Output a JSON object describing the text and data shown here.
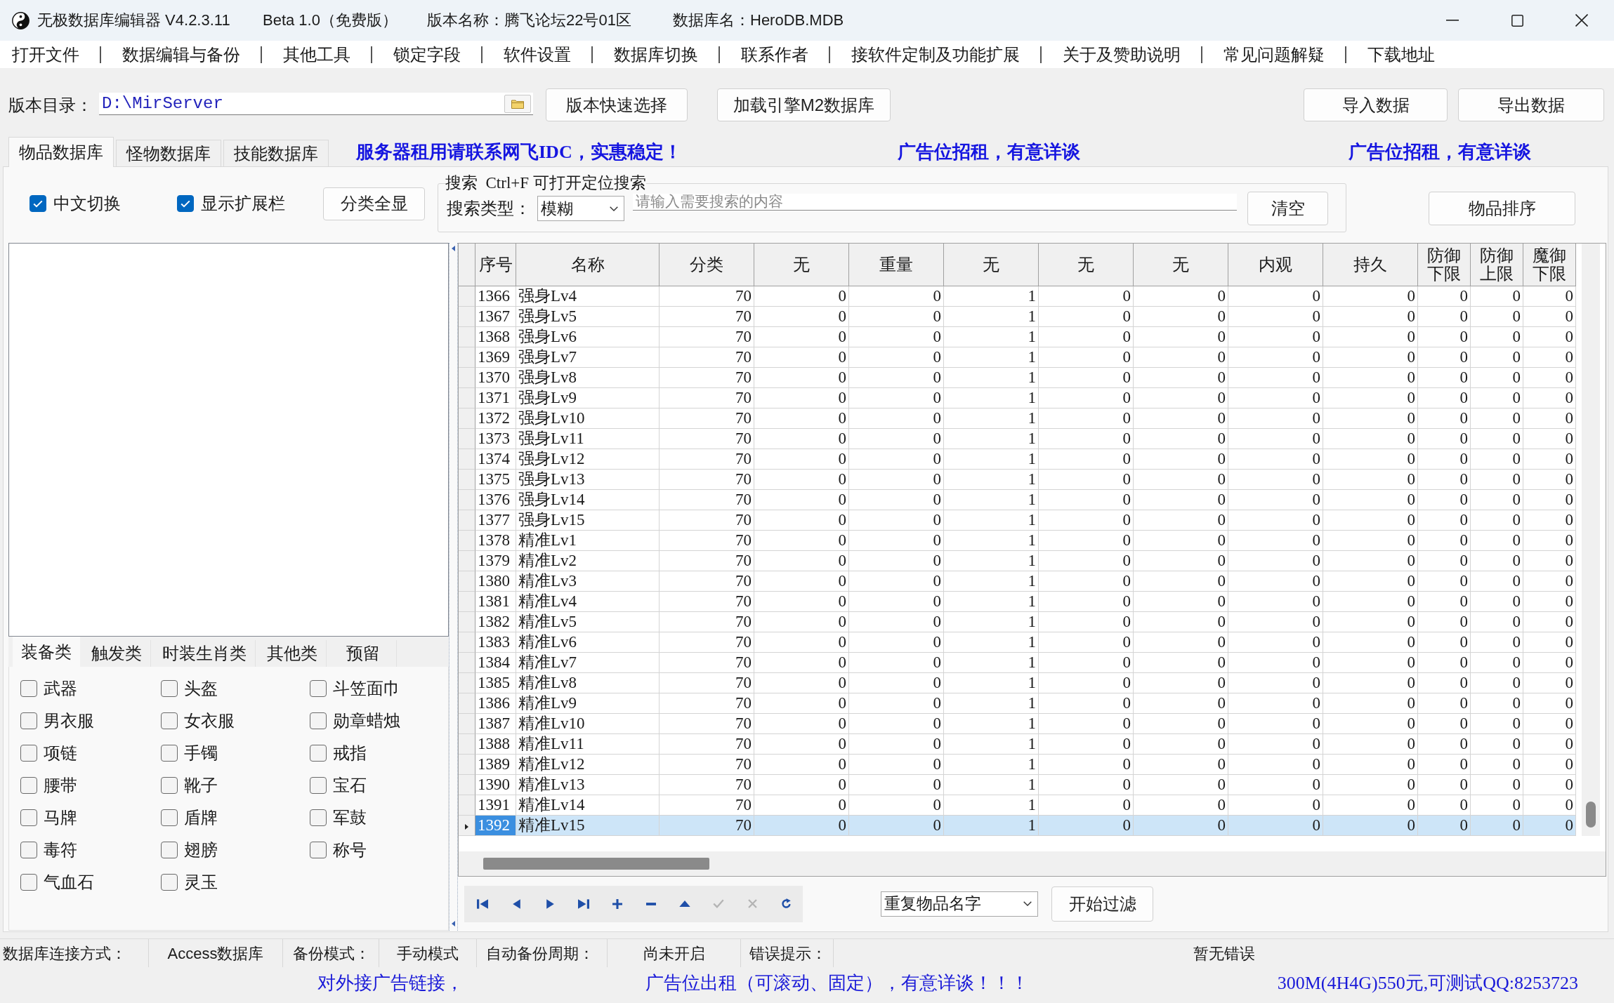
{
  "window": {
    "title": "无极数据库编辑器 V4.2.3.11",
    "edition": "Beta 1.0（免费版）",
    "version_name": "版本名称：腾飞论坛22号01区",
    "database_name": "数据库名：HeroDB.MDB"
  },
  "menu": [
    "打开文件",
    "数据编辑与备份",
    "其他工具",
    "锁定字段",
    "软件设置",
    "数据库切换",
    "联系作者",
    "接软件定制及功能扩展",
    "关于及赞助说明",
    "常见问题解疑",
    "下载地址"
  ],
  "toolbar": {
    "directory_label": "版本目录：",
    "directory_value": "D:\\MirServer",
    "quick_select_button": "版本快速选择",
    "load_m2_button": "加载引擎M2数据库",
    "import_button": "导入数据",
    "export_button": "导出数据"
  },
  "tabs": [
    {
      "label": "物品数据库",
      "selected": true
    },
    {
      "label": "怪物数据库",
      "selected": false
    },
    {
      "label": "技能数据库",
      "selected": false
    }
  ],
  "banner_texts": [
    "服务器租用请联系网飞IDC，实惠稳定！",
    "广告位招租，有意详谈",
    "广告位招租，有意详谈"
  ],
  "options": {
    "checkboxes": [
      {
        "label": "中文切换",
        "checked": true
      },
      {
        "label": "显示扩展栏",
        "checked": true
      }
    ],
    "show_all_button": "分类全显"
  },
  "search": {
    "title": "搜索  Ctrl+F 可打开定位搜索",
    "type_label": "搜索类型：",
    "type_value": "模糊",
    "placeholder": "请输入需要搜索的内容",
    "clear_button": "清空"
  },
  "sort_button": "物品排序",
  "category_tabs": [
    {
      "label": "装备类",
      "selected": true
    },
    {
      "label": "触发类",
      "selected": false
    },
    {
      "label": "时装生肖类",
      "selected": false
    },
    {
      "label": "其他类",
      "selected": false
    },
    {
      "label": "预留",
      "selected": false
    }
  ],
  "categories": [
    {
      "label": "武器",
      "checked": false
    },
    {
      "label": "头盔",
      "checked": false
    },
    {
      "label": "斗笠面巾",
      "checked": false
    },
    {
      "label": "男衣服",
      "checked": false
    },
    {
      "label": "女衣服",
      "checked": false
    },
    {
      "label": "勋章蜡烛",
      "checked": false
    },
    {
      "label": "项链",
      "checked": false
    },
    {
      "label": "手镯",
      "checked": false
    },
    {
      "label": "戒指",
      "checked": false
    },
    {
      "label": "腰带",
      "checked": false
    },
    {
      "label": "靴子",
      "checked": false
    },
    {
      "label": "宝石",
      "checked": false
    },
    {
      "label": "马牌",
      "checked": false
    },
    {
      "label": "盾牌",
      "checked": false
    },
    {
      "label": "军鼓",
      "checked": false
    },
    {
      "label": "毒符",
      "checked": false
    },
    {
      "label": "翅膀",
      "checked": false
    },
    {
      "label": "称号",
      "checked": false
    },
    {
      "label": "气血石",
      "checked": false
    },
    {
      "label": "灵玉",
      "checked": false
    }
  ],
  "table": {
    "columns": [
      "序号",
      "名称",
      "分类",
      "无",
      "重量",
      "无",
      "无",
      "无",
      "内观",
      "持久",
      "防御下限",
      "防御上限",
      "魔御下限"
    ],
    "rows": [
      {
        "selected": false,
        "cells": [
          "1366",
          "强身Lv4",
          "70",
          "0",
          "0",
          "1",
          "0",
          "0",
          "0",
          "0",
          "0",
          "0",
          "0"
        ]
      },
      {
        "selected": false,
        "cells": [
          "1367",
          "强身Lv5",
          "70",
          "0",
          "0",
          "1",
          "0",
          "0",
          "0",
          "0",
          "0",
          "0",
          "0"
        ]
      },
      {
        "selected": false,
        "cells": [
          "1368",
          "强身Lv6",
          "70",
          "0",
          "0",
          "1",
          "0",
          "0",
          "0",
          "0",
          "0",
          "0",
          "0"
        ]
      },
      {
        "selected": false,
        "cells": [
          "1369",
          "强身Lv7",
          "70",
          "0",
          "0",
          "1",
          "0",
          "0",
          "0",
          "0",
          "0",
          "0",
          "0"
        ]
      },
      {
        "selected": false,
        "cells": [
          "1370",
          "强身Lv8",
          "70",
          "0",
          "0",
          "1",
          "0",
          "0",
          "0",
          "0",
          "0",
          "0",
          "0"
        ]
      },
      {
        "selected": false,
        "cells": [
          "1371",
          "强身Lv9",
          "70",
          "0",
          "0",
          "1",
          "0",
          "0",
          "0",
          "0",
          "0",
          "0",
          "0"
        ]
      },
      {
        "selected": false,
        "cells": [
          "1372",
          "强身Lv10",
          "70",
          "0",
          "0",
          "1",
          "0",
          "0",
          "0",
          "0",
          "0",
          "0",
          "0"
        ]
      },
      {
        "selected": false,
        "cells": [
          "1373",
          "强身Lv11",
          "70",
          "0",
          "0",
          "1",
          "0",
          "0",
          "0",
          "0",
          "0",
          "0",
          "0"
        ]
      },
      {
        "selected": false,
        "cells": [
          "1374",
          "强身Lv12",
          "70",
          "0",
          "0",
          "1",
          "0",
          "0",
          "0",
          "0",
          "0",
          "0",
          "0"
        ]
      },
      {
        "selected": false,
        "cells": [
          "1375",
          "强身Lv13",
          "70",
          "0",
          "0",
          "1",
          "0",
          "0",
          "0",
          "0",
          "0",
          "0",
          "0"
        ]
      },
      {
        "selected": false,
        "cells": [
          "1376",
          "强身Lv14",
          "70",
          "0",
          "0",
          "1",
          "0",
          "0",
          "0",
          "0",
          "0",
          "0",
          "0"
        ]
      },
      {
        "selected": false,
        "cells": [
          "1377",
          "强身Lv15",
          "70",
          "0",
          "0",
          "1",
          "0",
          "0",
          "0",
          "0",
          "0",
          "0",
          "0"
        ]
      },
      {
        "selected": false,
        "cells": [
          "1378",
          "精准Lv1",
          "70",
          "0",
          "0",
          "1",
          "0",
          "0",
          "0",
          "0",
          "0",
          "0",
          "0"
        ]
      },
      {
        "selected": false,
        "cells": [
          "1379",
          "精准Lv2",
          "70",
          "0",
          "0",
          "1",
          "0",
          "0",
          "0",
          "0",
          "0",
          "0",
          "0"
        ]
      },
      {
        "selected": false,
        "cells": [
          "1380",
          "精准Lv3",
          "70",
          "0",
          "0",
          "1",
          "0",
          "0",
          "0",
          "0",
          "0",
          "0",
          "0"
        ]
      },
      {
        "selected": false,
        "cells": [
          "1381",
          "精准Lv4",
          "70",
          "0",
          "0",
          "1",
          "0",
          "0",
          "0",
          "0",
          "0",
          "0",
          "0"
        ]
      },
      {
        "selected": false,
        "cells": [
          "1382",
          "精准Lv5",
          "70",
          "0",
          "0",
          "1",
          "0",
          "0",
          "0",
          "0",
          "0",
          "0",
          "0"
        ]
      },
      {
        "selected": false,
        "cells": [
          "1383",
          "精准Lv6",
          "70",
          "0",
          "0",
          "1",
          "0",
          "0",
          "0",
          "0",
          "0",
          "0",
          "0"
        ]
      },
      {
        "selected": false,
        "cells": [
          "1384",
          "精准Lv7",
          "70",
          "0",
          "0",
          "1",
          "0",
          "0",
          "0",
          "0",
          "0",
          "0",
          "0"
        ]
      },
      {
        "selected": false,
        "cells": [
          "1385",
          "精准Lv8",
          "70",
          "0",
          "0",
          "1",
          "0",
          "0",
          "0",
          "0",
          "0",
          "0",
          "0"
        ]
      },
      {
        "selected": false,
        "cells": [
          "1386",
          "精准Lv9",
          "70",
          "0",
          "0",
          "1",
          "0",
          "0",
          "0",
          "0",
          "0",
          "0",
          "0"
        ]
      },
      {
        "selected": false,
        "cells": [
          "1387",
          "精准Lv10",
          "70",
          "0",
          "0",
          "1",
          "0",
          "0",
          "0",
          "0",
          "0",
          "0",
          "0"
        ]
      },
      {
        "selected": false,
        "cells": [
          "1388",
          "精准Lv11",
          "70",
          "0",
          "0",
          "1",
          "0",
          "0",
          "0",
          "0",
          "0",
          "0",
          "0"
        ]
      },
      {
        "selected": false,
        "cells": [
          "1389",
          "精准Lv12",
          "70",
          "0",
          "0",
          "1",
          "0",
          "0",
          "0",
          "0",
          "0",
          "0",
          "0"
        ]
      },
      {
        "selected": false,
        "cells": [
          "1390",
          "精准Lv13",
          "70",
          "0",
          "0",
          "1",
          "0",
          "0",
          "0",
          "0",
          "0",
          "0",
          "0"
        ]
      },
      {
        "selected": false,
        "cells": [
          "1391",
          "精准Lv14",
          "70",
          "0",
          "0",
          "1",
          "0",
          "0",
          "0",
          "0",
          "0",
          "0",
          "0"
        ]
      },
      {
        "selected": true,
        "cells": [
          "1392",
          "精准Lv15",
          "70",
          "0",
          "0",
          "1",
          "0",
          "0",
          "0",
          "0",
          "0",
          "0",
          "0"
        ]
      }
    ]
  },
  "navigator": [
    {
      "kind": "first",
      "disabled": false
    },
    {
      "kind": "prior",
      "disabled": false
    },
    {
      "kind": "next",
      "disabled": false
    },
    {
      "kind": "last",
      "disabled": false
    },
    {
      "kind": "insert",
      "disabled": false
    },
    {
      "kind": "delete",
      "disabled": false
    },
    {
      "kind": "edit",
      "disabled": false
    },
    {
      "kind": "post",
      "disabled": true
    },
    {
      "kind": "cancel",
      "disabled": true
    },
    {
      "kind": "refresh",
      "disabled": false
    }
  ],
  "filter": {
    "value": "重复物品名字",
    "button": "开始过滤"
  },
  "status_bar": [
    {
      "label": "数据库连接方式：",
      "value": "Access数据库"
    },
    {
      "label": "备份模式：",
      "value": "手动模式"
    },
    {
      "label": "自动备份周期：",
      "value": "尚未开启"
    },
    {
      "label": "错误提示：",
      "value": "暂无错误"
    }
  ],
  "footer": [
    "对外接广告链接，",
    "广告位出租（可滚动、固定），有意详谈！！！",
    "300M(4H4G)550元,可测试QQ:8253723"
  ]
}
